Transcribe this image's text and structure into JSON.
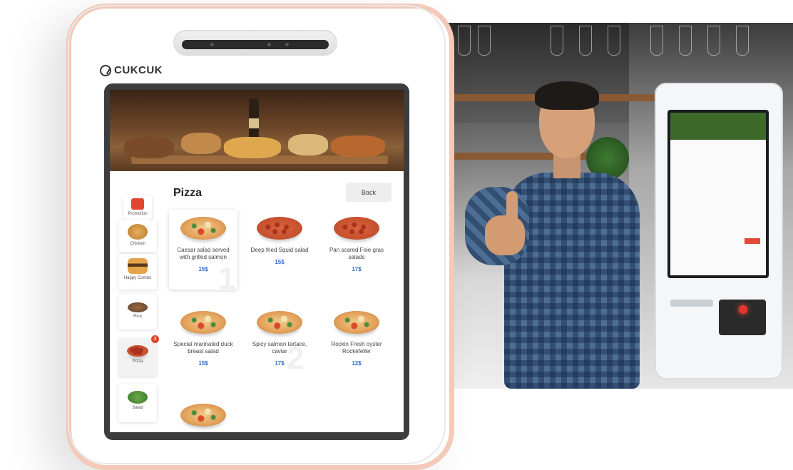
{
  "brand": {
    "logo_text": "CUKCUK"
  },
  "menu": {
    "title": "Pizza",
    "back_label": "Back",
    "categories": [
      {
        "label": "Promotion",
        "icon": "gift-icon"
      },
      {
        "label": "Chicken",
        "icon": "chicken-icon"
      },
      {
        "label": "Happy Combo",
        "icon": "burger-icon"
      },
      {
        "label": "Rice",
        "icon": "rice-icon"
      },
      {
        "label": "Pizza",
        "icon": "pizza-icon",
        "badge": "3",
        "selected": true
      },
      {
        "label": "Salad",
        "icon": "salad-icon"
      }
    ],
    "items": [
      {
        "name": "Caesar salad served with grilled salmon",
        "price": "15$"
      },
      {
        "name": "Deep fried Squid salad",
        "price": "15$"
      },
      {
        "name": "Pan scared Foie gras salads",
        "price": "17$"
      },
      {
        "name": "Special marinated duck breast salad",
        "price": "15$"
      },
      {
        "name": "Spicy salmon tartace, caviar",
        "price": "17$"
      },
      {
        "name": "Rockin Fresh oyster Rockefeller",
        "price": "12$"
      }
    ],
    "page_markers": [
      "1",
      "2"
    ]
  },
  "colors": {
    "frame_accent": "#f3c9b8",
    "price_blue": "#2f6fd6",
    "badge_red": "#e0452d"
  }
}
